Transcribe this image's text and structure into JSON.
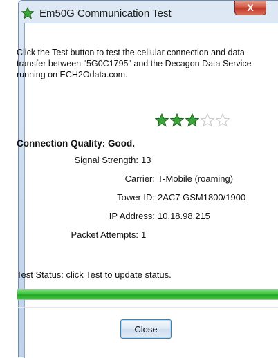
{
  "window": {
    "title": "Em50G Communication Test",
    "close_glyph": "X"
  },
  "intro_text": "Click the Test button to test the cellular connection and data transfer between \"5G0C1795\" and the Decagon Data Service running on ECH2Odata.com.",
  "rating": {
    "filled": 3,
    "total": 5
  },
  "quality": "Connection Quality: Good.",
  "details": [
    {
      "label": "Signal Strength:",
      "value": "13"
    },
    {
      "label": "Carrier:",
      "value": "T-Mobile (roaming)"
    },
    {
      "label": "Tower ID:",
      "value": "2AC7 GSM1800/1900"
    },
    {
      "label": "IP Address:",
      "value": "10.18.98.215"
    },
    {
      "label": "Packet Attempts:",
      "value": "1"
    }
  ],
  "status_text": "Test Status: click Test to update status.",
  "progress_fraction": 1.0,
  "buttons": {
    "close_label": "Close"
  },
  "colors": {
    "star_fill": "#3aa63a",
    "star_outline": "#1f5f1f",
    "progress": "#3fc13f"
  }
}
